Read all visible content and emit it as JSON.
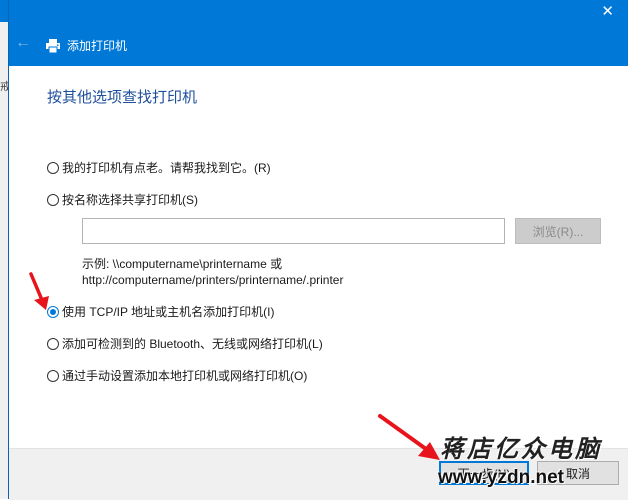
{
  "background_window": {
    "side_text": "戒"
  },
  "titlebar": {
    "close_icon": "✕"
  },
  "nav": {
    "back_icon": "←",
    "title": "添加打印机"
  },
  "heading": "按其他选项查找打印机",
  "options": [
    {
      "label": "我的打印机有点老。请帮我找到它。(R)",
      "checked": false
    },
    {
      "label": "按名称选择共享打印机(S)",
      "checked": false
    },
    {
      "label": "使用 TCP/IP 地址或主机名添加打印机(I)",
      "checked": true
    },
    {
      "label": "添加可检测到的 Bluetooth、无线或网络打印机(L)",
      "checked": false
    },
    {
      "label": "通过手动设置添加本地打印机或网络打印机(O)",
      "checked": false
    }
  ],
  "shared_printer": {
    "input_value": "",
    "browse_label": "浏览(R)...",
    "example_line1": "示例: \\\\computername\\printername 或",
    "example_line2": "http://computername/printers/printername/.printer"
  },
  "footer": {
    "next_label": "下一步(N)",
    "cancel_label": "取消"
  },
  "watermark": {
    "name": "蒋店亿众电脑",
    "url": "www.yzdn.net"
  },
  "colors": {
    "accent": "#0078d7",
    "heading": "#1e4f9c",
    "annotation_arrow": "#e8141b"
  }
}
